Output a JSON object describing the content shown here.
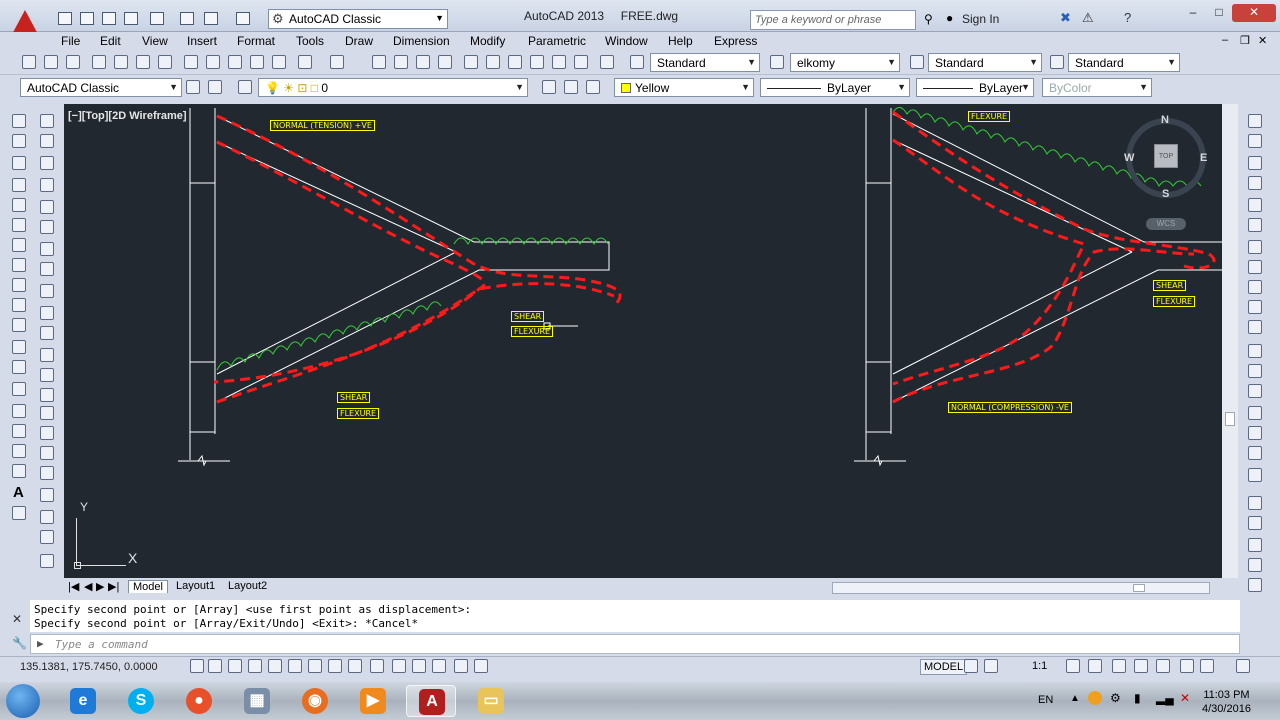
{
  "window": {
    "app_title": "AutoCAD 2013",
    "file_name": "FREE.dwg",
    "workspace": "AutoCAD Classic",
    "search_placeholder": "Type a keyword or phrase",
    "sign_in": "Sign In",
    "close": "✕",
    "minimize": "–",
    "maximize": "□"
  },
  "menu": [
    "File",
    "Edit",
    "View",
    "Insert",
    "Format",
    "Tools",
    "Draw",
    "Dimension",
    "Modify",
    "Parametric",
    "Window",
    "Help",
    "Express"
  ],
  "toolbar": {
    "text_style": "Standard",
    "dim_style": "elkomy",
    "table_style": "Standard",
    "multileader_style": "Standard",
    "workspace_select": "AutoCAD Classic",
    "layer": "0",
    "color": "Yellow",
    "linetype": "ByLayer",
    "lineweight": "ByLayer",
    "plotstyle": "ByColor"
  },
  "viewport": {
    "label": "[−][Top][2D Wireframe]",
    "viewcube": {
      "top": "TOP",
      "n": "N",
      "s": "S",
      "e": "E",
      "w": "W",
      "wcs": "WCS"
    },
    "ucs": {
      "x": "X",
      "y": "Y"
    }
  },
  "drawing_labels": {
    "normal_tension": "NORMAL (TENSION) +VE",
    "shear_1": "SHEAR",
    "flexure_1": "FLEXURE",
    "shear_2": "SHEAR",
    "flexure_2": "FLEXURE",
    "flexure_top_right": "FLEXURE",
    "shear_3": "SHEAR",
    "flexure_3": "FLEXURE",
    "normal_compression": "NORMAL (COMPRESSION) -VE"
  },
  "layout_tabs": [
    "Model",
    "Layout1",
    "Layout2"
  ],
  "command": {
    "history": [
      "Specify second point or [Array] <use first point as displacement>:",
      "Specify second point or [Array/Exit/Undo] <Exit>: *Cancel*"
    ],
    "placeholder": "Type a command"
  },
  "status": {
    "coordinates": "135.1381, 175.7450, 0.0000",
    "model": "MODEL",
    "scale": "1:1"
  },
  "taskbar": {
    "language": "EN",
    "time": "11:03 PM",
    "date": "4/30/2016",
    "apps": [
      "ie-icon",
      "skype-icon",
      "app-icon",
      "calculator-icon",
      "firefox-icon",
      "media-player-icon",
      "autocad-icon",
      "explorer-icon"
    ]
  },
  "colors": {
    "canvas": "#212830",
    "member_line": "#ffffff",
    "load_curve": "#ff1a1a",
    "label": "#ffff00",
    "wave": "#33cc33"
  }
}
